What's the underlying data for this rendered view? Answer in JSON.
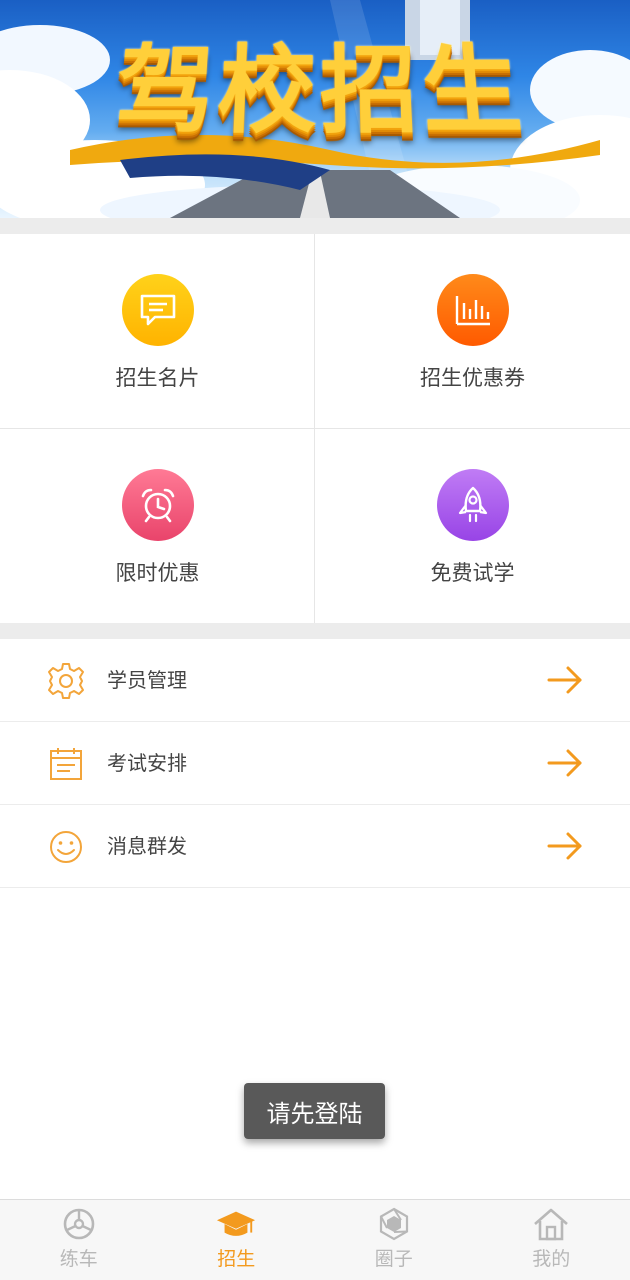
{
  "banner": {
    "title": "驾校招生"
  },
  "grid": [
    {
      "label": "招生名片",
      "icon": "message-card-icon",
      "color_top": "#ffd21a",
      "color_bottom": "#ffb300"
    },
    {
      "label": "招生优惠券",
      "icon": "bar-chart-icon",
      "color_top": "#ff8a1a",
      "color_bottom": "#ff5a00"
    },
    {
      "label": "限时优惠",
      "icon": "alarm-clock-icon",
      "color_top": "#ff7a95",
      "color_bottom": "#e9446b"
    },
    {
      "label": "免费试学",
      "icon": "rocket-icon",
      "color_top": "#c07cf5",
      "color_bottom": "#9844e6"
    }
  ],
  "list": [
    {
      "label": "学员管理",
      "icon": "gear-icon"
    },
    {
      "label": "考试安排",
      "icon": "calendar-icon"
    },
    {
      "label": "消息群发",
      "icon": "smiley-icon"
    }
  ],
  "toast": {
    "text": "请先登陆"
  },
  "tabbar": {
    "active_color": "#f39a1e",
    "inactive_color": "#b8b8b8",
    "tabs": [
      {
        "label": "练车",
        "icon": "steering-wheel-icon",
        "active": false
      },
      {
        "label": "招生",
        "icon": "graduation-cap-icon",
        "active": true
      },
      {
        "label": "圈子",
        "icon": "aperture-icon",
        "active": false
      },
      {
        "label": "我的",
        "icon": "home-icon",
        "active": false
      }
    ]
  },
  "accent_color": "#f39a1e"
}
